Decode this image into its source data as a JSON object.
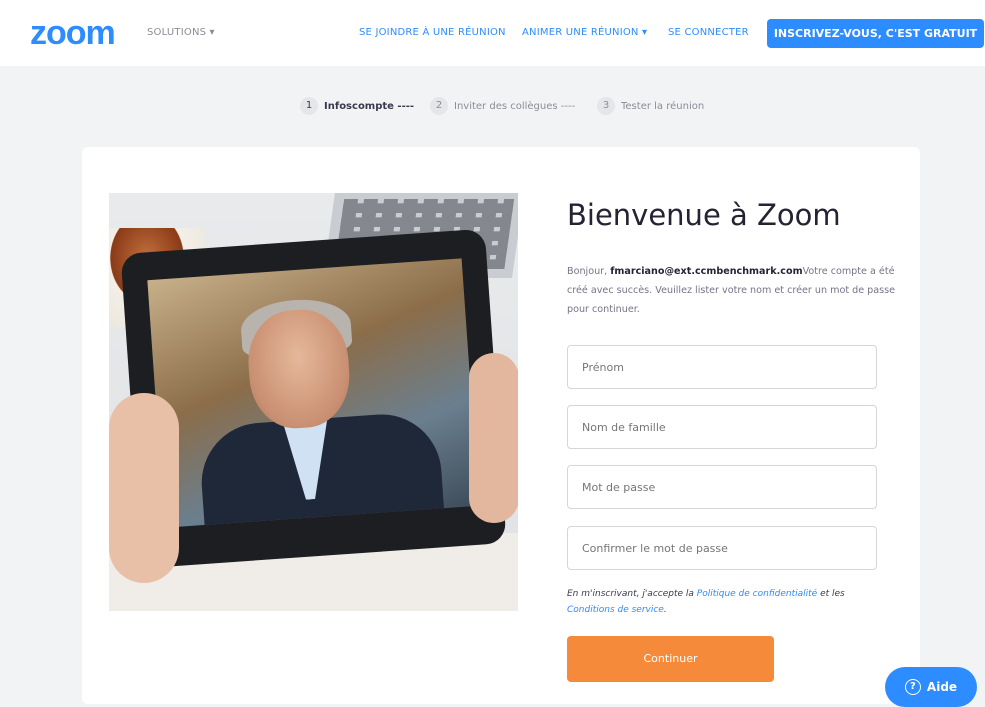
{
  "header": {
    "logo": "zoom",
    "solutions_label": "SOLUTIONS ▾",
    "join_label": "SE JOINDRE À UNE RÉUNION",
    "host_label": "ANIMER UNE RÉUNION ▾",
    "signin_label": "SE CONNECTER",
    "signup_label": "INSCRIVEZ-VOUS, C'EST GRATUIT"
  },
  "steps": [
    {
      "num": "1",
      "label": "Infoscompte ----"
    },
    {
      "num": "2",
      "label": "Inviter des collègues ----"
    },
    {
      "num": "3",
      "label": "Tester la réunion"
    }
  ],
  "form": {
    "title": "Bienvenue à Zoom",
    "intro_pre": "Bonjour, ",
    "email": "fmarciano@ext.ccmbenchmark.com",
    "intro_post": "Votre compte a été créé avec succès. Veuillez lister votre nom et créer un mot de passe pour continuer.",
    "first_name_placeholder": "Prénom",
    "last_name_placeholder": "Nom de famille",
    "password_placeholder": "Mot de passe",
    "confirm_placeholder": "Confirmer le mot de passe",
    "terms_pre": "En m'inscrivant, j'accepte la ",
    "privacy_link": "Politique de confidentialité",
    "terms_mid": " et les ",
    "service_link": "Conditions de service",
    "terms_end": ".",
    "continue_label": "Continuer"
  },
  "help": {
    "icon": "question-circle-icon",
    "label": "Aide"
  },
  "colors": {
    "accent": "#2d8cff",
    "cta": "#f58b3a"
  }
}
